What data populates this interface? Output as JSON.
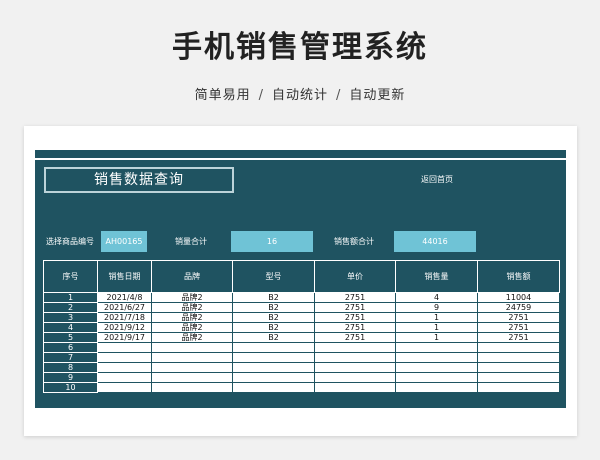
{
  "header": {
    "title": "手机销售管理系统",
    "tagline_parts": [
      "简单易用",
      "自动统计",
      "自动更新"
    ],
    "separator": "/"
  },
  "panel": {
    "query_title": "销售数据查询",
    "home_link": "返回首页",
    "filters": {
      "product_code_label": "选择商品编号",
      "product_code_value": "AH00165",
      "qty_total_label": "销量合计",
      "qty_total_value": "16",
      "amount_total_label": "销售额合计",
      "amount_total_value": "44016"
    }
  },
  "table": {
    "columns": [
      "序号",
      "销售日期",
      "品牌",
      "型号",
      "单价",
      "销售量",
      "销售额"
    ],
    "rows": [
      [
        "1",
        "2021/4/8",
        "品牌2",
        "B2",
        "2751",
        "4",
        "11004"
      ],
      [
        "2",
        "2021/6/27",
        "品牌2",
        "B2",
        "2751",
        "9",
        "24759"
      ],
      [
        "3",
        "2021/7/18",
        "品牌2",
        "B2",
        "2751",
        "1",
        "2751"
      ],
      [
        "4",
        "2021/9/12",
        "品牌2",
        "B2",
        "2751",
        "1",
        "2751"
      ],
      [
        "5",
        "2021/9/17",
        "品牌2",
        "B2",
        "2751",
        "1",
        "2751"
      ],
      [
        "6",
        "",
        "",
        "",
        "",
        "",
        ""
      ],
      [
        "7",
        "",
        "",
        "",
        "",
        "",
        ""
      ],
      [
        "8",
        "",
        "",
        "",
        "",
        "",
        ""
      ],
      [
        "9",
        "",
        "",
        "",
        "",
        "",
        ""
      ],
      [
        "10",
        "",
        "",
        "",
        "",
        "",
        ""
      ]
    ]
  },
  "colors": {
    "panel_bg": "#1f5361",
    "value_box": "#6fc3d6",
    "card_bg": "#ffffff",
    "page_bg": "#f1f1f1"
  }
}
